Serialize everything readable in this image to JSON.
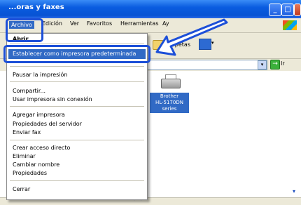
{
  "window": {
    "title": "Impresoras y faxes",
    "title_visible": "...oras y faxes"
  },
  "menubar": {
    "items": [
      "Archivo",
      "Edición",
      "Ver",
      "Favoritos",
      "Herramientas",
      "Ay"
    ]
  },
  "toolbar": {
    "folders_label": "Carpetas"
  },
  "address": {
    "go_label": "Ir"
  },
  "file_menu": {
    "first_item_partial": "Abrir",
    "highlighted": "Establecer como impresora predeterminada",
    "items": [
      "Pausar la impresión",
      "Compartir...",
      "Usar impresora sin conexión",
      "Agregar impresora",
      "Propiedades del servidor",
      "Enviar fax",
      "Crear acceso directo",
      "Eliminar",
      "Cambiar nombre",
      "Propiedades",
      "Cerrar"
    ]
  },
  "printer": {
    "label_lines": [
      "Brother",
      "HL-5170DN",
      "series"
    ]
  },
  "colors": {
    "callout": "#1c4fd8",
    "highlight": "#316ac5",
    "titlebar": "#0a5ce0"
  }
}
